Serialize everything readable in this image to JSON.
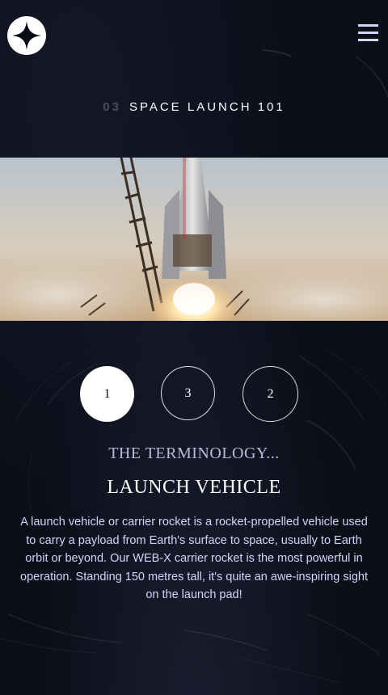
{
  "header": {
    "logo_icon": "star-logo-icon",
    "menu_icon": "hamburger-menu-icon"
  },
  "page_heading": {
    "number": "03",
    "title": "SPACE LAUNCH 101"
  },
  "hero_image": {
    "subject": "rocket-launch"
  },
  "slider": {
    "items": [
      {
        "label": "1",
        "active": true
      },
      {
        "label": "3",
        "active": false
      },
      {
        "label": "2",
        "active": false
      }
    ]
  },
  "content": {
    "subtitle": "THE TERMINOLOGY...",
    "name": "LAUNCH VEHICLE",
    "description": "A launch vehicle or carrier rocket is a rocket-propelled vehicle used to carry a payload from Earth's surface to space, usually to Earth orbit or beyond. Our WEB-X carrier rocket is the most powerful in operation. Standing 150 metres tall, it's quite an awe-inspiring sight on the launch pad!"
  },
  "colors": {
    "background": "#0b0d17",
    "accent": "#d0d6f9",
    "white": "#ffffff",
    "muted": "#4b4d57"
  }
}
